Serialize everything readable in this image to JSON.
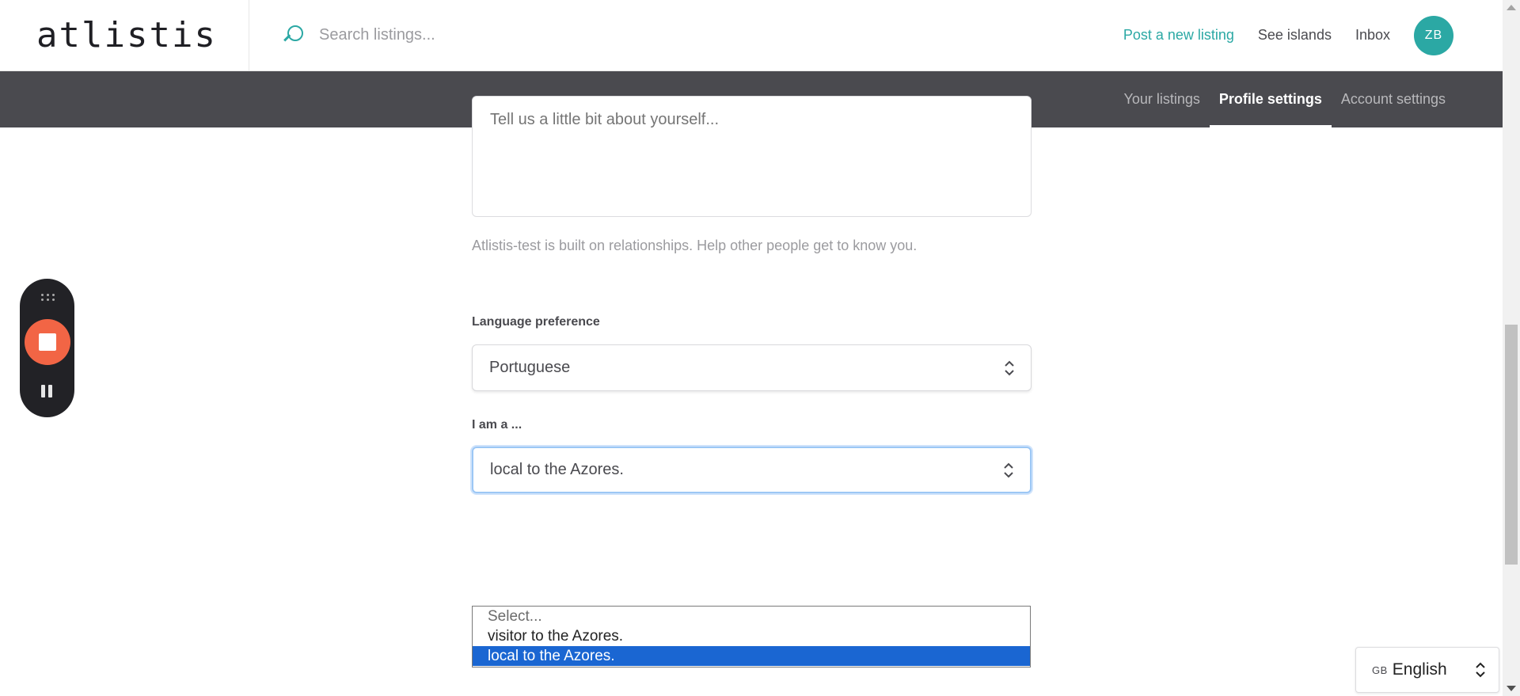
{
  "header": {
    "logo": "atlistis",
    "search_placeholder": "Search listings...",
    "links": {
      "post_listing": "Post a new listing",
      "see_islands": "See islands",
      "inbox": "Inbox"
    },
    "avatar_initials": "ZB",
    "accent_color": "#2ba8a4"
  },
  "subnav": {
    "tabs": [
      {
        "label": "Your listings",
        "active": false
      },
      {
        "label": "Profile settings",
        "active": true
      },
      {
        "label": "Account settings",
        "active": false
      }
    ]
  },
  "form": {
    "bio_placeholder": "Tell us a little bit about yourself...",
    "bio_helper": "Atlistis-test is built on relationships. Help other people get to know you.",
    "language": {
      "label": "Language preference",
      "value": "Portuguese"
    },
    "role": {
      "label": "I am a ...",
      "value": "local to the Azores.",
      "options": [
        "Select...",
        "visitor to the Azores.",
        "local to the Azores."
      ],
      "selected_index": 2
    }
  },
  "recorder": {
    "stop_color": "#f26545"
  },
  "site_language": {
    "flag": "GB",
    "label": "English"
  }
}
